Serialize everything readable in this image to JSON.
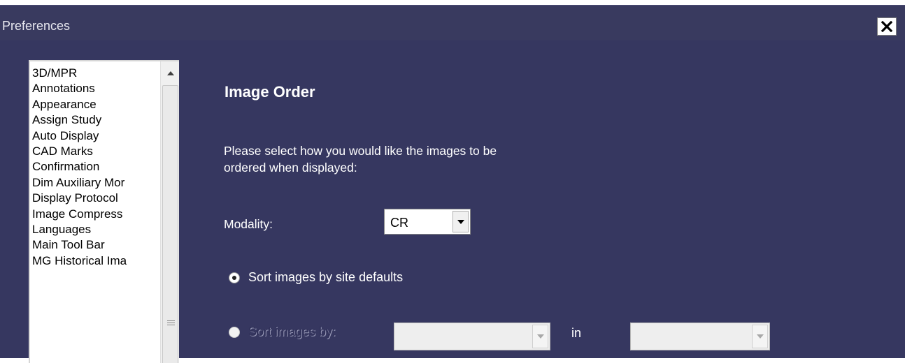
{
  "window": {
    "title": "Preferences",
    "close_glyph": "×",
    "background_color": "#363760"
  },
  "sidebar": {
    "items": [
      {
        "label": "3D/MPR"
      },
      {
        "label": "Annotations"
      },
      {
        "label": "Appearance"
      },
      {
        "label": "Assign Study"
      },
      {
        "label": "Auto Display"
      },
      {
        "label": "CAD Marks"
      },
      {
        "label": "Confirmation"
      },
      {
        "label": "Dim Auxiliary Mor"
      },
      {
        "label": "Display Protocol"
      },
      {
        "label": "Image Compress"
      },
      {
        "label": "Languages"
      },
      {
        "label": "Main Tool Bar"
      },
      {
        "label": "MG Historical Ima"
      }
    ]
  },
  "main": {
    "section_title": "Image Order",
    "instructions_line1": "Please select how you would like the images to be",
    "instructions_line2": "ordered when displayed:",
    "modality_label": "Modality:",
    "modality_value": "CR",
    "option_site_defaults_label": "Sort images by site defaults",
    "option_site_defaults_selected": true,
    "option_sort_by_label": "Sort images by:",
    "option_sort_by_selected": false,
    "sort_by_value": "",
    "in_label": "in",
    "order_value": ""
  }
}
